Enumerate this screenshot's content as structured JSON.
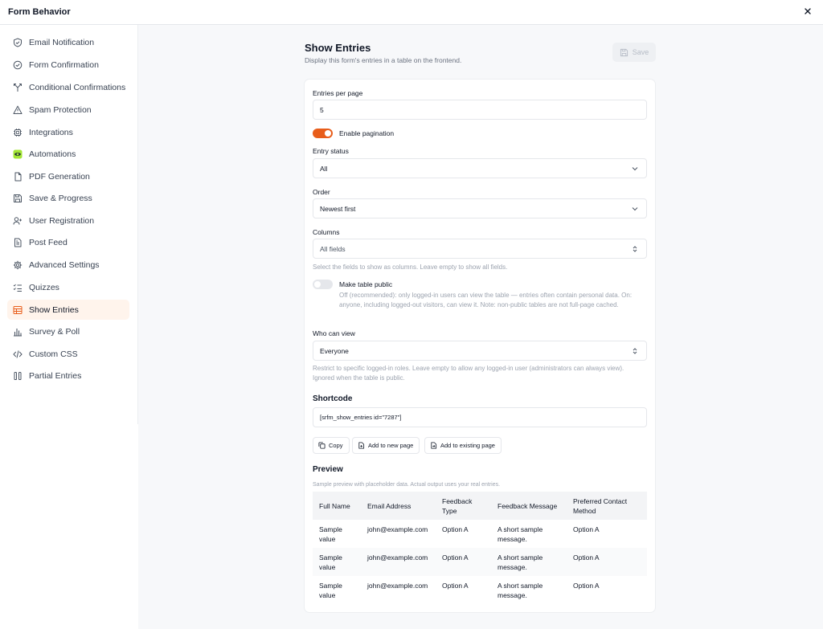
{
  "window": {
    "title": "Form Behavior"
  },
  "sidebar": {
    "items": [
      {
        "label": "Email Notification",
        "icon": "shield-check-icon"
      },
      {
        "label": "Form Confirmation",
        "icon": "check-circle-icon"
      },
      {
        "label": "Conditional Confirmations",
        "icon": "split-arrow-icon"
      },
      {
        "label": "Spam Protection",
        "icon": "warning-triangle-icon"
      },
      {
        "label": "Integrations",
        "icon": "chip-icon"
      },
      {
        "label": "Automations",
        "icon": "automation-eye-icon"
      },
      {
        "label": "PDF Generation",
        "icon": "document-icon"
      },
      {
        "label": "Save & Progress",
        "icon": "floppy-disk-icon"
      },
      {
        "label": "User Registration",
        "icon": "user-plus-icon"
      },
      {
        "label": "Post Feed",
        "icon": "file-text-icon"
      },
      {
        "label": "Advanced Settings",
        "icon": "gear-icon"
      },
      {
        "label": "Quizzes",
        "icon": "list-check-icon"
      },
      {
        "label": "Show Entries",
        "icon": "table-icon",
        "active": true
      },
      {
        "label": "Survey & Poll",
        "icon": "bar-chart-icon"
      },
      {
        "label": "Custom CSS",
        "icon": "code-icon"
      },
      {
        "label": "Partial Entries",
        "icon": "columns-icon"
      }
    ]
  },
  "header": {
    "title": "Show Entries",
    "subtitle": "Display this form's entries in a table on the frontend.",
    "save_label": "Save"
  },
  "form": {
    "entries_per_page": {
      "label": "Entries per page",
      "value": "5"
    },
    "pagination": {
      "label": "Enable pagination",
      "enabled": true
    },
    "entry_status": {
      "label": "Entry status",
      "value": "All"
    },
    "order": {
      "label": "Order",
      "value": "Newest first"
    },
    "columns": {
      "label": "Columns",
      "value": "All fields",
      "help": "Select the fields to show as columns. Leave empty to show all fields."
    },
    "public": {
      "label": "Make table public",
      "enabled": false,
      "help": "Off (recommended): only logged-in users can view the table — entries often contain personal data. On: anyone, including logged-out visitors, can view it. Note: non-public tables are not full-page cached."
    },
    "who_can_view": {
      "label": "Who can view",
      "value": "Everyone",
      "help": "Restrict to specific logged-in roles. Leave empty to allow any logged-in user (administrators can always view). Ignored when the table is public."
    },
    "shortcode": {
      "label": "Shortcode",
      "value": "[srfm_show_entries id=\"7287\"]",
      "copy_label": "Copy",
      "new_page_label": "Add to new page",
      "existing_page_label": "Add to existing page"
    }
  },
  "preview": {
    "title": "Preview",
    "note": "Sample preview with placeholder data. Actual output uses your real entries.",
    "headers": [
      "Full Name",
      "Email Address",
      "Feedback Type",
      "Feedback Message",
      "Preferred Contact Method"
    ],
    "rows": [
      [
        "Sample value",
        "john@example.com",
        "Option A",
        "A short sample message.",
        "Option A"
      ],
      [
        "Sample value",
        "john@example.com",
        "Option A",
        "A short sample message.",
        "Option A"
      ],
      [
        "Sample value",
        "john@example.com",
        "Option A",
        "A short sample message.",
        "Option A"
      ]
    ]
  },
  "colors": {
    "accent": "#e85d1a",
    "active_bg": "#fff4ec",
    "automations_badge": "#a3e635"
  }
}
